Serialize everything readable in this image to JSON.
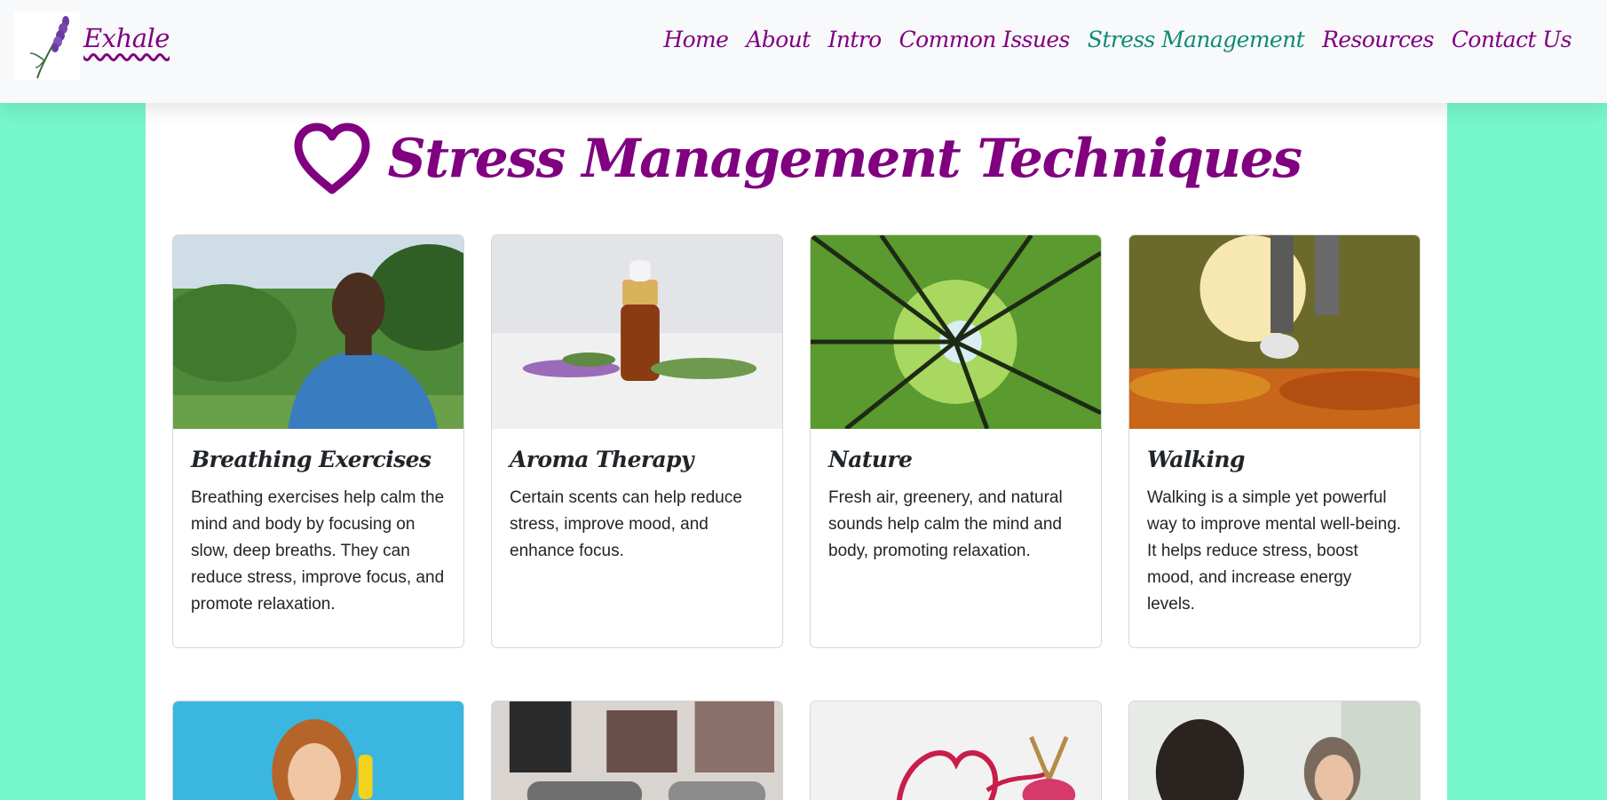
{
  "brand": {
    "name": "Exhale",
    "logo_icon": "lavender-sprig-icon"
  },
  "nav": {
    "items": [
      {
        "label": "Home",
        "active": false
      },
      {
        "label": "About",
        "active": false
      },
      {
        "label": "Intro",
        "active": false
      },
      {
        "label": "Common Issues",
        "active": false
      },
      {
        "label": "Stress Management",
        "active": true
      },
      {
        "label": "Resources",
        "active": false
      },
      {
        "label": "Contact Us",
        "active": false
      }
    ]
  },
  "colors": {
    "page_background": "#77f7cc",
    "brand_purple": "#800080",
    "active_teal": "#0f8a76",
    "navbar_background": "#f8f9fa"
  },
  "page": {
    "title_icon": "heart-outline-icon",
    "title": "Stress Management Techniques"
  },
  "cards": [
    {
      "image": "man-breathing-outdoors-photo",
      "title": "Breathing Exercises",
      "text": "Breathing exercises help calm the mind and body by focusing on slow, deep breaths. They can reduce stress, improve focus, and promote relaxation."
    },
    {
      "image": "essential-oil-bottle-with-herbs-photo",
      "title": "Aroma Therapy",
      "text": "Certain scents can help reduce stress, improve mood, and enhance focus."
    },
    {
      "image": "forest-canopy-from-below-photo",
      "title": "Nature",
      "text": "Fresh air, greenery, and natural sounds help calm the mind and body, promoting relaxation."
    },
    {
      "image": "feet-walking-on-autumn-leaves-photo",
      "title": "Walking",
      "text": "Walking is a simple yet powerful way to improve mental well-being. It helps reduce stress, boost mood, and increase energy levels."
    }
  ],
  "cards_row2": [
    {
      "image": "laughing-woman-on-phone-photo"
    },
    {
      "image": "group-yoga-mats-photo"
    },
    {
      "image": "heart-shaped-yarn-knitting-photo"
    },
    {
      "image": "therapy-conversation-photo"
    }
  ]
}
